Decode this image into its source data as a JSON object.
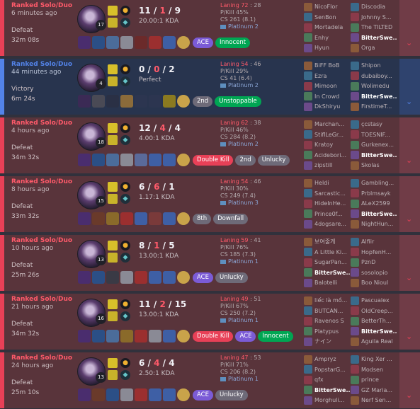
{
  "matches": [
    {
      "queue": "Ranked Solo/Duo",
      "ago": "6 minutes ago",
      "result": "Defeat",
      "duration": "32m 08s",
      "level": "17",
      "k": "11",
      "d": "1",
      "a": "9",
      "ratio": "20.00:1 KDA",
      "laning_label": "Laning 72",
      "laning_val": ": 28",
      "pkill": "P/Kill 45%",
      "cs": "CS 261 (8.1)",
      "tier": "Platinum 2",
      "items": [
        "#4a2d6e",
        "#2b4f86",
        "#4b6c9a",
        "#8a8a95",
        "#6b2a2a",
        "#9b2f2f",
        "#3e5fa5"
      ],
      "badges": [
        {
          "text": "ACE",
          "style": "ace"
        },
        {
          "text": "Innocent",
          "style": "green"
        }
      ],
      "team1": [
        "NicoFlor",
        "SenBon",
        "Mortadela",
        "Enhy",
        "Hyun"
      ],
      "team2": [
        "Discodia",
        "Johnny S...",
        "The TILTED",
        "BitterSwe...",
        "Orga"
      ],
      "me_team": 2,
      "me_index": 3,
      "win": false
    },
    {
      "queue": "Ranked Solo/Duo",
      "ago": "44 minutes ago",
      "result": "Victory",
      "duration": "6m 24s",
      "level": "4",
      "k": "0",
      "d": "0",
      "a": "2",
      "ratio": "Perfect",
      "laning_label": "Laning 54",
      "laning_val": ": 46",
      "pkill": "P/Kill 29%",
      "cs": "CS 41 (6.4)",
      "tier": "Platinum 2",
      "items": [
        "#3b2a55",
        "#4a4a55",
        "#2a3045",
        "#8b6b3a",
        "#2c3550",
        "#2c3550",
        "#8b7a20"
      ],
      "badges": [
        {
          "text": "2nd",
          "style": "grey"
        },
        {
          "text": "Unstoppable",
          "style": "green"
        }
      ],
      "team1": [
        "BiFF BoB",
        "Ezra",
        "Mimoon",
        "In Crowd",
        "DkShiryu"
      ],
      "team2": [
        "Shipon",
        "dubaiboy...",
        "Wolimedu",
        "BitterSwe...",
        "FirstimeT..."
      ],
      "me_team": 2,
      "me_index": 3,
      "win": true
    },
    {
      "queue": "Ranked Solo/Duo",
      "ago": "4 hours ago",
      "result": "Defeat",
      "duration": "34m 32s",
      "level": "18",
      "k": "12",
      "d": "4",
      "a": "4",
      "ratio": "4.00:1 KDA",
      "laning_label": "Laning 62",
      "laning_val": ": 38",
      "pkill": "P/Kill 46%",
      "cs": "CS 284 (8.2)",
      "tier": "Platinum 2",
      "items": [
        "#4a2d6e",
        "#2b4f86",
        "#4b6c9a",
        "#8a8a95",
        "#5a6a9a",
        "#3e5fa5",
        "#3e5fa5"
      ],
      "badges": [
        {
          "text": "Double Kill",
          "style": "red"
        },
        {
          "text": "2nd",
          "style": "grey"
        },
        {
          "text": "Unlucky",
          "style": "grey"
        }
      ],
      "team1": [
        "Marchan...",
        "StiflLeGr...",
        "Kratoy",
        "Acidebori...",
        "zipstill"
      ],
      "team2": [
        "çcstasy",
        "TOESNIF...",
        "Gurkenex...",
        "BitterSwe...",
        "Skolas"
      ],
      "me_team": 2,
      "me_index": 3,
      "win": false
    },
    {
      "queue": "Ranked Solo/Duo",
      "ago": "8 hours ago",
      "result": "Defeat",
      "duration": "33m 32s",
      "level": "15",
      "k": "6",
      "d": "6",
      "a": "1",
      "ratio": "1.17:1 KDA",
      "laning_label": "Laning 54",
      "laning_val": ": 46",
      "pkill": "P/Kill 30%",
      "cs": "CS 249 (7.4)",
      "tier": "Platinum 3",
      "items": [
        "#4a2d6e",
        "#6a3a2a",
        "#8a6a2a",
        "#9b2f2f",
        "#3e5fa5",
        "#7a3a3a",
        "#3e5fa5"
      ],
      "badges": [
        {
          "text": "8th",
          "style": "grey"
        },
        {
          "text": "Downfall",
          "style": "grey"
        }
      ],
      "team1": [
        "Heldi",
        "Sarcastic...",
        "HideInHe...",
        "Prince0f...",
        "4dogsare..."
      ],
      "team2": [
        "Gambling...",
        "Prblmsayk",
        "ALeX2599",
        "BitterSwe...",
        "NightHun..."
      ],
      "me_team": 2,
      "me_index": 3,
      "win": false
    },
    {
      "queue": "Ranked Solo/Duo",
      "ago": "10 hours ago",
      "result": "Defeat",
      "duration": "25m 26s",
      "level": "13",
      "k": "8",
      "d": "1",
      "a": "5",
      "ratio": "13.00:1 KDA",
      "laning_label": "Laning 59",
      "laning_val": ": 41",
      "pkill": "P/Kill 76%",
      "cs": "CS 185 (7.3)",
      "tier": "Platinum 1",
      "items": [
        "#4a2d6e",
        "#2b4f86",
        "#3a3a45",
        "#8a8a95",
        "#9b2f2f",
        "#3e5fa5",
        "#3e5fa5"
      ],
      "badges": [
        {
          "text": "ACE",
          "style": "ace"
        },
        {
          "text": "Unlucky",
          "style": "grey"
        }
      ],
      "team1": [
        "보여줄게",
        "A Little Ki...",
        "SugarPan...",
        "BitterSwe...",
        "Balotelli"
      ],
      "team2": [
        "Alfiir",
        "HopfenH...",
        "PznD",
        "sosolopio",
        "Boo Nioul"
      ],
      "me_team": 1,
      "me_index": 3,
      "win": false
    },
    {
      "queue": "Ranked Solo/Duo",
      "ago": "21 hours ago",
      "result": "Defeat",
      "duration": "34m 32s",
      "level": "16",
      "k": "11",
      "d": "2",
      "a": "15",
      "ratio": "13.00:1 KDA",
      "laning_label": "Laning 49",
      "laning_val": ": 51",
      "pkill": "P/Kill 67%",
      "cs": "CS 250 (7.2)",
      "tier": "Platinum 1",
      "items": [
        "#4a2d6e",
        "#2b4f86",
        "#4b6c9a",
        "#8a6a2a",
        "#9b2f2f",
        "#8a8a95",
        "#3e5fa5"
      ],
      "badges": [
        {
          "text": "Double Kill",
          "style": "red"
        },
        {
          "text": "ACE",
          "style": "ace"
        },
        {
          "text": "Innocent",
          "style": "green"
        }
      ],
      "team1": [
        "liếc là mồ...",
        "BUTCAN...",
        "Ravenos S",
        "Platypus",
        "ナイン"
      ],
      "team2": [
        "Pascualex",
        "OldCreep...",
        "BetterTh...",
        "BitterSwe...",
        "Aguila Real"
      ],
      "me_team": 2,
      "me_index": 3,
      "win": false
    },
    {
      "queue": "Ranked Solo/Duo",
      "ago": "24 hours ago",
      "result": "Defeat",
      "duration": "25m 10s",
      "level": "13",
      "k": "6",
      "d": "4",
      "a": "4",
      "ratio": "2.50:1 KDA",
      "laning_label": "Laning 47",
      "laning_val": ": 53",
      "pkill": "P/Kill 71%",
      "cs": "CS 206 (8.2)",
      "tier": "Platinum 1",
      "items": [
        "#4a2d6e",
        "#6a3a2a",
        "#2b4f86",
        "#8a8a95",
        "#9b2f2f",
        "#3e5fa5",
        "#3e5fa5"
      ],
      "badges": [
        {
          "text": "ACE",
          "style": "ace"
        },
        {
          "text": "Unlucky",
          "style": "grey"
        }
      ],
      "team1": [
        "Ampryz",
        "PopstarG...",
        "qfx",
        "BitterSwe...",
        "Morghuli..."
      ],
      "team2": [
        "King Xer ...",
        "Modsen",
        "prince",
        "GZ Maria...",
        "Nerf Sen..."
      ],
      "me_team": 1,
      "me_index": 3,
      "win": false
    }
  ]
}
